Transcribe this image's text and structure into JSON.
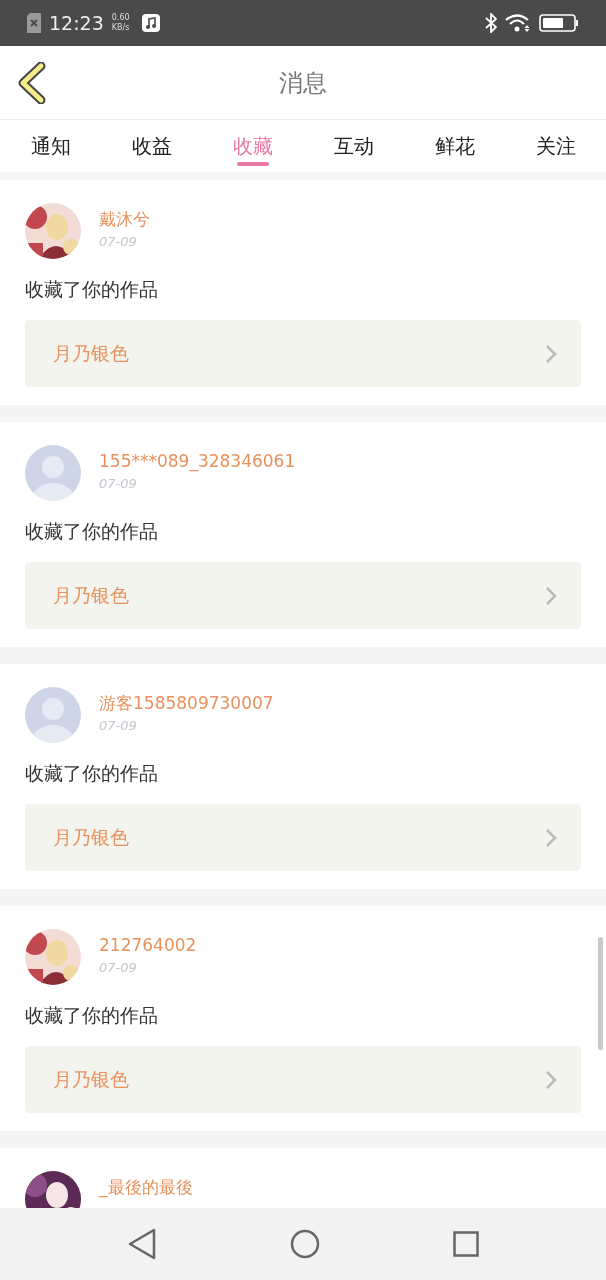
{
  "status_bar": {
    "time": "12:23",
    "speed_value": "0.60",
    "speed_unit": "KB/s"
  },
  "header": {
    "title": "消息"
  },
  "tabs": [
    {
      "label": "通知",
      "selected": false
    },
    {
      "label": "收益",
      "selected": false
    },
    {
      "label": "收藏",
      "selected": true
    },
    {
      "label": "互动",
      "selected": false
    },
    {
      "label": "鲜花",
      "selected": false
    },
    {
      "label": "关注",
      "selected": false
    }
  ],
  "messages": [
    {
      "kind": "picture",
      "name": "戴沐兮",
      "date": "07-09",
      "text": "收藏了你的作品",
      "work": "月乃银色"
    },
    {
      "kind": "default",
      "name": "155***089_328346061",
      "date": "07-09",
      "text": "收藏了你的作品",
      "work": "月乃银色"
    },
    {
      "kind": "default",
      "name": "游客1585809730007",
      "date": "07-09",
      "text": "收藏了你的作品",
      "work": "月乃银色"
    },
    {
      "kind": "picture",
      "name": "212764002",
      "date": "07-09",
      "text": "收藏了你的作品",
      "work": "月乃银色"
    },
    {
      "kind": "picture",
      "name": "_最後的最後"
    }
  ]
}
